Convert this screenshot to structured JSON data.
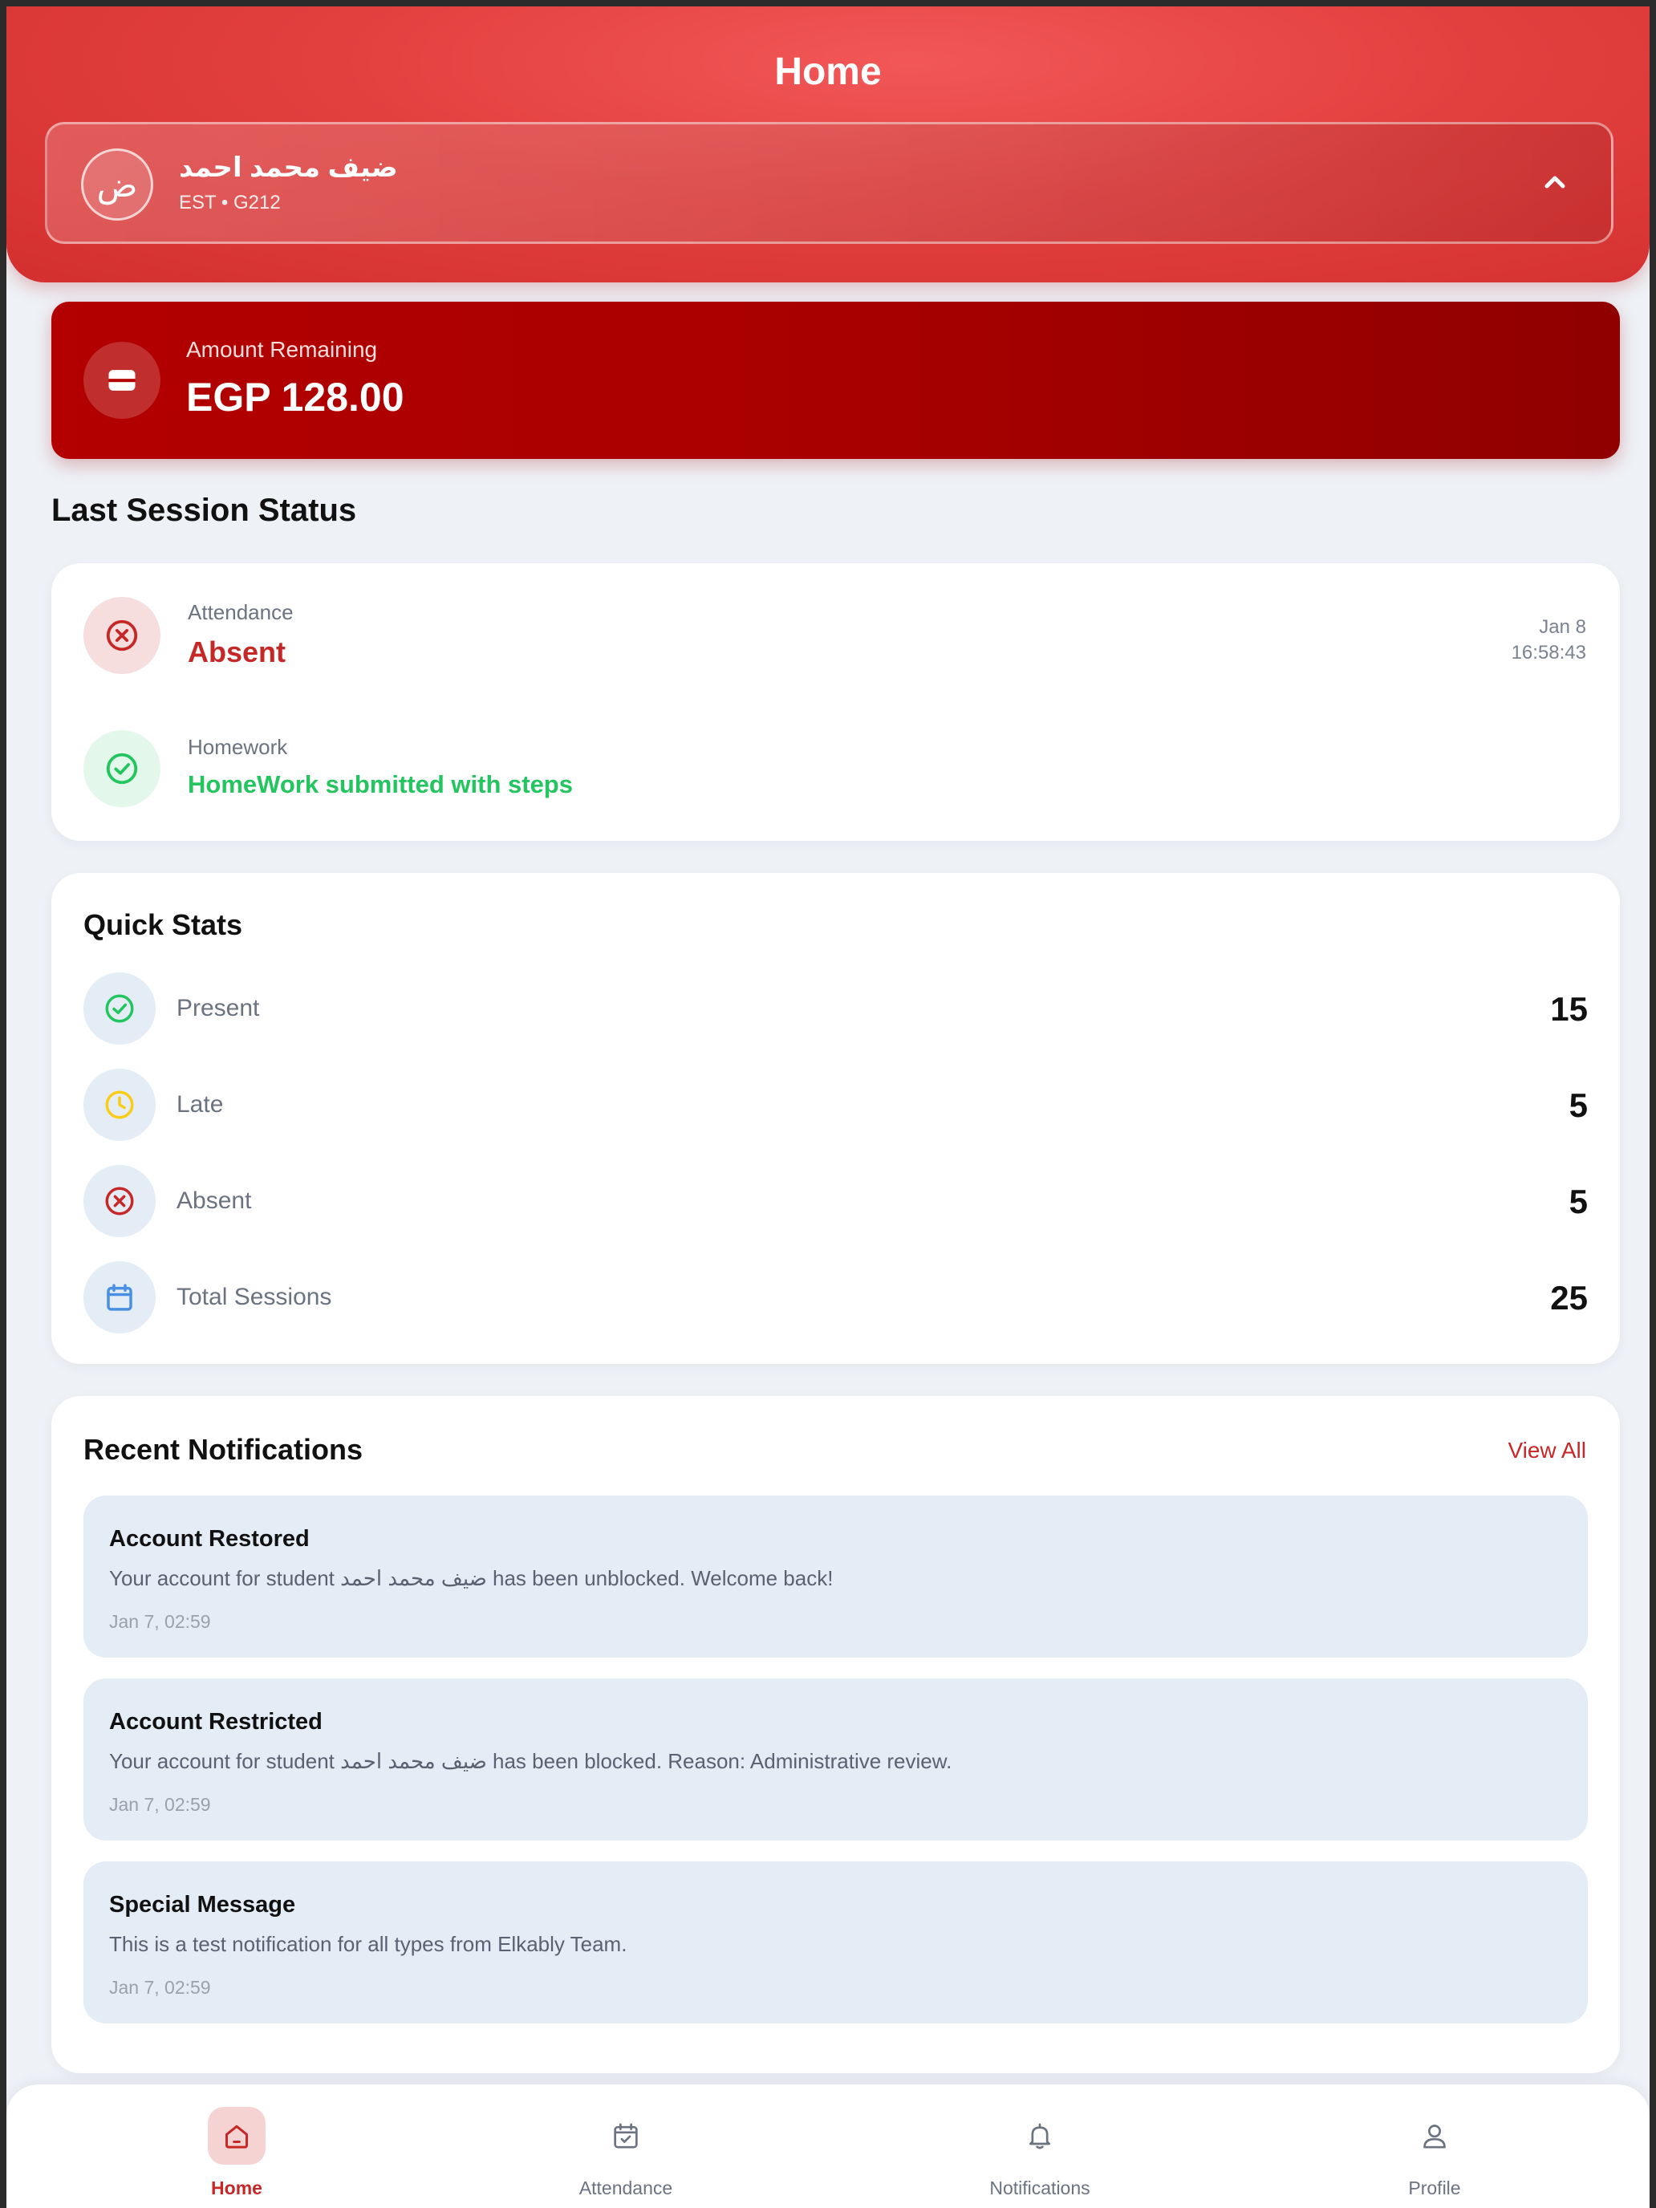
{
  "header": {
    "title": "Home"
  },
  "student": {
    "avatar_letter": "ض",
    "name": "ضيف محمد احمد",
    "meta": "EST • G212"
  },
  "amount": {
    "label": "Amount Remaining",
    "value": "EGP 128.00"
  },
  "last_session": {
    "title": "Last Session Status",
    "attendance": {
      "label": "Attendance",
      "value": "Absent",
      "date": "Jan 8",
      "time": "16:58:43"
    },
    "homework": {
      "label": "Homework",
      "value": "HomeWork submitted with steps"
    }
  },
  "quick_stats": {
    "title": "Quick Stats",
    "items": [
      {
        "label": "Present",
        "value": "15",
        "icon": "check-circle-icon",
        "color": "#22c55e"
      },
      {
        "label": "Late",
        "value": "5",
        "icon": "clock-icon",
        "color": "#facc15"
      },
      {
        "label": "Absent",
        "value": "5",
        "icon": "x-circle-icon",
        "color": "#c62828"
      },
      {
        "label": "Total Sessions",
        "value": "25",
        "icon": "calendar-icon",
        "color": "#4a90e2"
      }
    ]
  },
  "notifications": {
    "title": "Recent Notifications",
    "view_all": "View All",
    "items": [
      {
        "title": "Account Restored",
        "body": "Your account for student ضيف محمد احمد has been unblocked. Welcome back!",
        "time": "Jan 7, 02:59"
      },
      {
        "title": "Account Restricted",
        "body": "Your account for student ضيف محمد احمد has been blocked. Reason: Administrative review.",
        "time": "Jan 7, 02:59"
      },
      {
        "title": "Special Message",
        "body": "This is a test notification for all types from Elkably Team.",
        "time": "Jan 7, 02:59"
      }
    ]
  },
  "nav": {
    "items": [
      {
        "label": "Home",
        "icon": "home-icon",
        "active": true
      },
      {
        "label": "Attendance",
        "icon": "calendar-check-icon",
        "active": false
      },
      {
        "label": "Notifications",
        "icon": "bell-icon",
        "active": false
      },
      {
        "label": "Profile",
        "icon": "user-icon",
        "active": false
      }
    ]
  },
  "colors": {
    "primary": "#c62828",
    "success": "#22c55e",
    "warning": "#facc15",
    "info": "#4a90e2"
  }
}
